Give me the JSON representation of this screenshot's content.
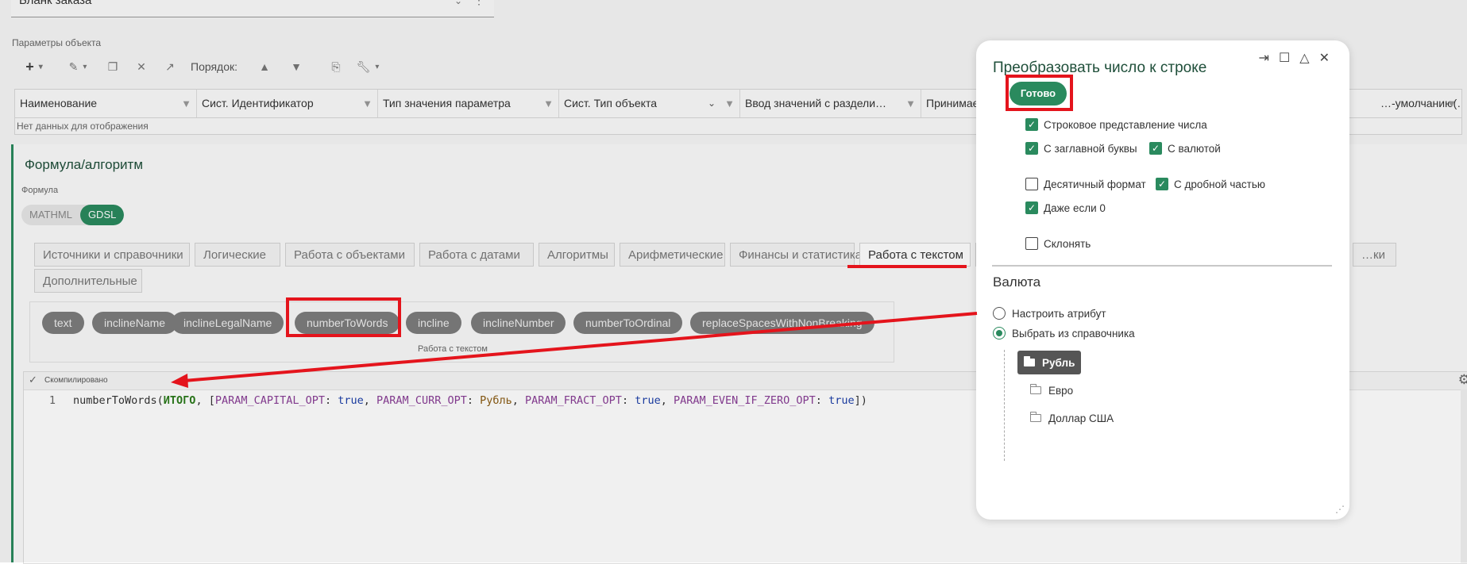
{
  "top": {
    "field_value": "Бланк заказа"
  },
  "params_section": {
    "label": "Параметры объекта"
  },
  "toolbar": {
    "order_label": "Порядок:"
  },
  "grid": {
    "columns": [
      "Наименование",
      "Сист. Идентификатор",
      "Тип значения параметра",
      "Сист. Тип объекта",
      "Ввод значений с раздели…",
      "Принимает",
      "…-умолчанию(…"
    ],
    "empty_text": "Нет данных для отображения"
  },
  "formula": {
    "title": "Формула/алгоритм",
    "subtitle": "Формула",
    "modes": [
      "MATHML",
      "GDSL"
    ],
    "tabs": [
      "Источники и справочники",
      "Логические",
      "Работа с объектами",
      "Работа с датами",
      "Алгоритмы",
      "Арифметические",
      "Финансы и статистика",
      "Работа с текстом",
      "…ки",
      "Дополнительные"
    ],
    "functions": [
      "text",
      "inclineName",
      "inclineLegalName",
      "numberToWords",
      "incline",
      "inclineNumber",
      "numberToOrdinal",
      "replaceSpacesWithNonBreaking"
    ],
    "ops_caption": "Работа с текстом",
    "editor": {
      "status": "Скомпилировано",
      "line_number": "1",
      "code": {
        "fn": "numberToWords(",
        "arg": "ИТОГО",
        "sep1": ", [",
        "p1": "PARAM_CAPITAL_OPT",
        "c1": ": ",
        "v1": "true",
        "sep2": ", ",
        "p2": "PARAM_CURR_OPT",
        "c2": ": ",
        "v2": "Рубль",
        "sep3": ", ",
        "p3": "PARAM_FRACT_OPT",
        "c3": ": ",
        "v3": "true",
        "sep4": ", ",
        "p4": "PARAM_EVEN_IF_ZERO_OPT",
        "c4": ": ",
        "v4": "true",
        "end": "])"
      }
    }
  },
  "dialog": {
    "title": "Преобразовать число к строке",
    "ready_label": "Готово",
    "options": {
      "string_repr": {
        "label": "Строковое представление числа",
        "checked": true
      },
      "capital": {
        "label": "С заглавной буквы",
        "checked": true
      },
      "currency": {
        "label": "С валютой",
        "checked": true
      },
      "decimal": {
        "label": "Десятичный формат",
        "checked": false
      },
      "fraction": {
        "label": "С дробной частью",
        "checked": true
      },
      "even_if_zero": {
        "label": "Даже если 0",
        "checked": true
      },
      "decline": {
        "label": "Склонять",
        "checked": false
      }
    },
    "currency_heading": "Валюта",
    "radio": {
      "attribute": "Настроить атрибут",
      "dictionary": "Выбрать из справочника"
    },
    "tree": [
      "Рубль",
      "Евро",
      "Доллар США"
    ]
  },
  "colors": {
    "accent": "#2a8a5e",
    "annotation": "#e4141c"
  }
}
